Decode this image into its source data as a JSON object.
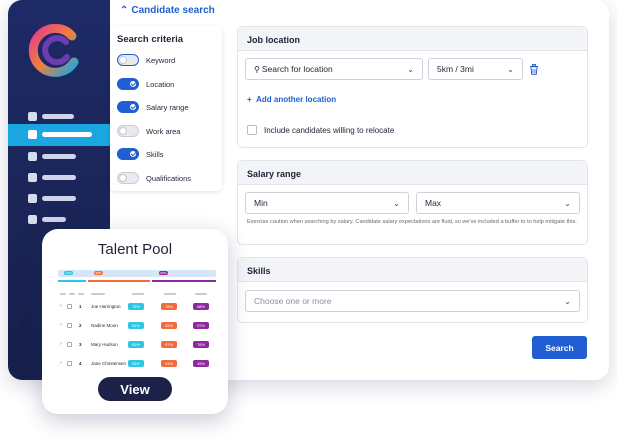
{
  "header": {
    "title": "Candidate search"
  },
  "criteria": {
    "title": "Search criteria",
    "items": [
      {
        "label": "Keyword",
        "on": false
      },
      {
        "label": "Location",
        "on": true
      },
      {
        "label": "Salary range",
        "on": true
      },
      {
        "label": "Work area",
        "on": false
      },
      {
        "label": "Skills",
        "on": true
      },
      {
        "label": "Qualifications",
        "on": false
      }
    ]
  },
  "location": {
    "title": "Job location",
    "search_placeholder": "Search for location",
    "radius": "5km / 3mi",
    "add_link": "Add another location",
    "relocate_label": "Include candidates willing to relocate"
  },
  "salary": {
    "title": "Salary range",
    "min": "Min",
    "max": "Max",
    "note": "Exercise caution when searching by salary. Candidate salary expectations are fluid, so we've included a buffer to to help mitigate this."
  },
  "skills": {
    "title": "Skills",
    "placeholder": "Choose one or more"
  },
  "search_button": "Search",
  "talent_pool": {
    "title": "Talent Pool",
    "head_chips": [
      "72%",
      "58%",
      "89%"
    ],
    "rows": [
      {
        "num": "1",
        "name": "Joe Harrington",
        "scores": [
          "75%",
          "76%",
          "88%"
        ]
      },
      {
        "num": "2",
        "name": "Nadine Moon",
        "scores": [
          "81%",
          "52%",
          "97%"
        ]
      },
      {
        "num": "3",
        "name": "Mary Hudson",
        "scores": [
          "81%",
          "97%",
          "76%"
        ]
      },
      {
        "num": "4",
        "name": "Jane Christensen",
        "scores": [
          "55%",
          "91%",
          "45%"
        ]
      }
    ],
    "view_button": "View"
  },
  "colors": {
    "primary": "#1f5fd1",
    "sidebar": "#1e2a66",
    "nav_active": "#1aa6e0",
    "score_cyan": "#2ec4e6",
    "score_orange": "#f26b3a",
    "score_purple": "#8e2a9e"
  }
}
